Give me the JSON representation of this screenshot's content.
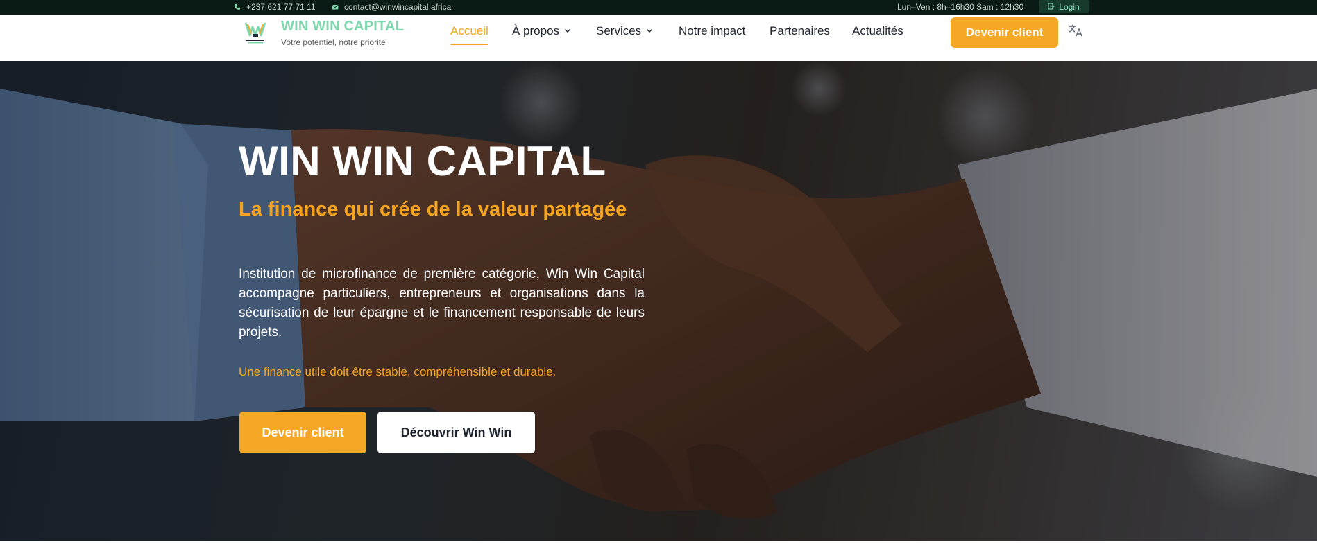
{
  "topbar": {
    "phone": "+237 621 77 71 11",
    "email": "contact@winwincapital.africa",
    "hours": "Lun–Ven : 8h–16h30 Sam : 12h30",
    "login_label": "Login"
  },
  "header": {
    "brand_title": "WIN WIN CAPITAL",
    "brand_subtitle": "Votre potentiel, notre priorité",
    "nav": [
      {
        "label": "Accueil",
        "active": true
      },
      {
        "label": "À propos",
        "dropdown": true
      },
      {
        "label": "Services",
        "dropdown": true
      },
      {
        "label": "Notre impact"
      },
      {
        "label": "Partenaires"
      },
      {
        "label": "Actualités"
      }
    ],
    "cta_label": "Devenir client",
    "language_icon": "translate-icon"
  },
  "hero": {
    "title": "WIN WIN CAPITAL",
    "subtitle": "La finance qui crée de la valeur partagée",
    "description": "Institution de microfinance de première catégorie, Win Win Capital accompagne particuliers, entrepreneurs et organisations dans la sécurisation de leur épargne et le financement responsable de leurs projets.",
    "tagline": "Une finance utile doit être stable, compréhensible et durable.",
    "primary_button": "Devenir client",
    "secondary_button": "Découvrir Win Win"
  },
  "colors": {
    "accent": "#f4a826",
    "brand_green": "#7fd8ad",
    "topbar_bg": "#0a1a14"
  }
}
